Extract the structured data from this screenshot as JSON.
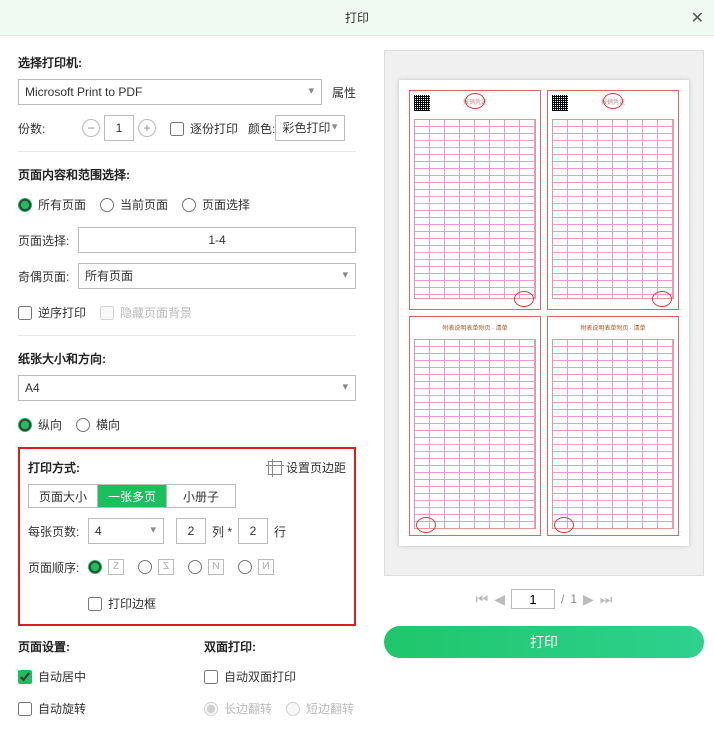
{
  "title": "打印",
  "printer": {
    "label": "选择打印机:",
    "selected": "Microsoft Print to PDF",
    "prop_btn": "属性"
  },
  "copies": {
    "label": "份数:",
    "value": "1",
    "collate_label": "逐份打印"
  },
  "color": {
    "label": "颜色:",
    "selected": "彩色打印"
  },
  "range": {
    "header": "页面内容和范围选择:",
    "all": "所有页面",
    "current": "当前页面",
    "custom": "页面选择",
    "custom_label": "页面选择:",
    "custom_value": "1-4",
    "parity_label": "奇偶页面:",
    "parity_selected": "所有页面",
    "reverse": "逆序打印",
    "hide_bg": "隐藏页面背景"
  },
  "paper": {
    "header": "纸张大小和方向:",
    "size": "A4",
    "portrait": "纵向",
    "landscape": "横向"
  },
  "layout": {
    "header": "打印方式:",
    "margin_link": "设置页边距",
    "tab_fit": "页面大小",
    "tab_multi": "一张多页",
    "tab_booklet": "小册子",
    "per_sheet_label": "每张页数:",
    "per_sheet": "4",
    "cols": "2",
    "cols_lbl": "列 *",
    "rows": "2",
    "rows_lbl": "行",
    "order_label": "页面顺序:",
    "border_label": "打印边框"
  },
  "pageset": {
    "header": "页面设置:",
    "center": "自动居中",
    "rotate": "自动旋转"
  },
  "duplex": {
    "header": "双面打印:",
    "auto": "自动双面打印",
    "long": "长边翻转",
    "short": "短边翻转"
  },
  "pager": {
    "page": "1",
    "sep": "/",
    "total": "1"
  },
  "print_button": "打印"
}
